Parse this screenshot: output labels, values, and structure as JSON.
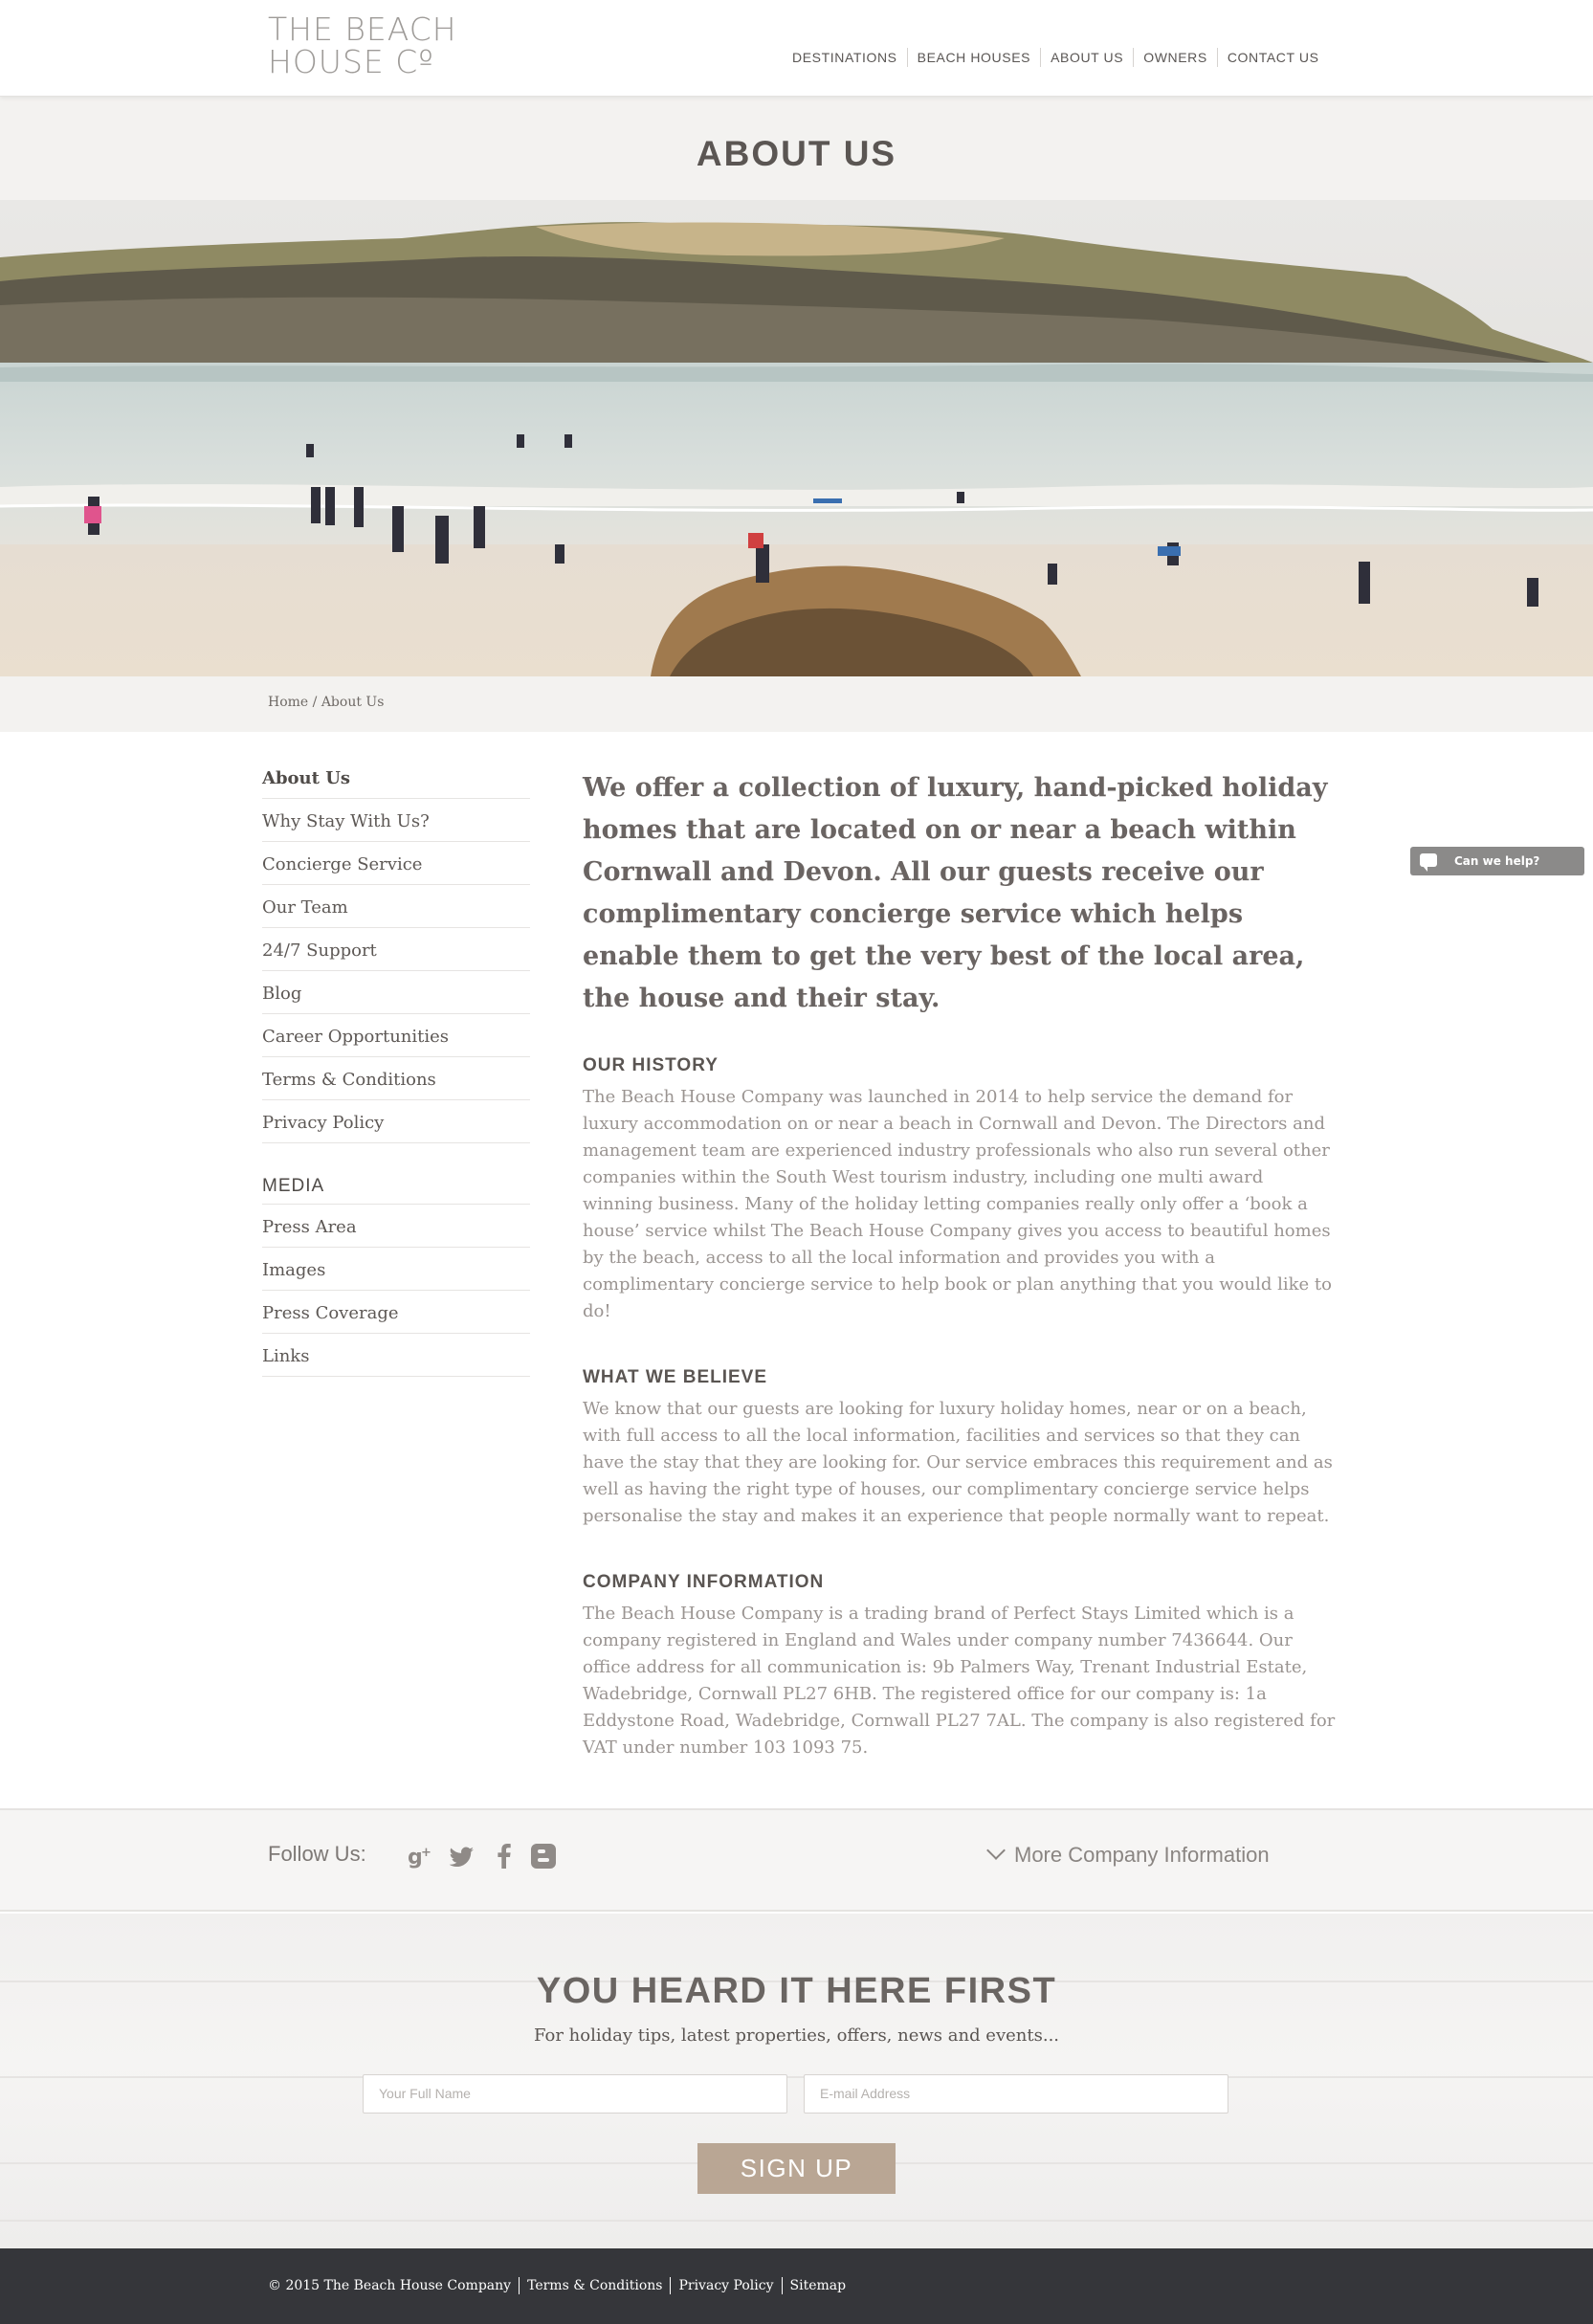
{
  "header": {
    "logo_line1": "THE BEACH",
    "logo_line2": "HOUSE Cº",
    "nav": [
      "DESTINATIONS",
      "BEACH HOUSES",
      "ABOUT US",
      "OWNERS",
      "CONTACT US"
    ]
  },
  "page_title": "ABOUT US",
  "breadcrumb": "Home / About Us",
  "sidebar": {
    "items": [
      "About Us",
      "Why Stay With Us?",
      "Concierge Service",
      "Our Team",
      "24/7 Support",
      "Blog",
      "Career Opportunities",
      "Terms & Conditions",
      "Privacy Policy"
    ],
    "media_heading": "MEDIA",
    "media_items": [
      "Press Area",
      "Images",
      "Press Coverage",
      "Links"
    ]
  },
  "main": {
    "lead": "We offer a collection of luxury, hand-picked holiday homes that are located on or near a beach within Cornwall and Devon. All our guests receive  our complimentary concierge service which helps enable them to get the very best of the local area, the house and their stay.",
    "history_heading": "OUR HISTORY",
    "history_text": "The Beach House Company was launched in 2014  to help service the demand for luxury accommodation on or near a beach in Cornwall and Devon. The Directors and management team are experienced industry professionals who also run several other companies within the South West tourism industry, including one multi award winning business. Many of the holiday letting companies really only offer a ‘book a  house’ service whilst The Beach House Company gives you access to beautiful homes by the beach, access to all the local information and provides you with a complimentary concierge service to help book or plan anything that you would like to do!",
    "believe_heading": "WHAT WE BELIEVE",
    "believe_text": "We  know that our guests are looking for luxury holiday homes, near or on a beach, with full access to all the local information, facilities and services so that they can have the stay that they are looking for. Our service embraces this requirement and as well as having the right type of houses, our complimentary concierge service helps personalise the stay and makes it an experience that people normally want to repeat.",
    "company_heading": "COMPANY INFORMATION",
    "company_text": "The Beach House Company is a trading brand of Perfect Stays Limited which is a company registered in England and Wales under company number 7436644. Our office address for all communication is: 9b Palmers Way, Trenant Industrial Estate, Wadebridge, Cornwall PL27 6HB. The registered office for our company is: 1a Eddystone Road, Wadebridge, Cornwall PL27 7AL. The company is also registered for VAT under number 103 1093 75."
  },
  "chat": {
    "label": "Can we help?",
    "icon": "speech-bubble-icon"
  },
  "follow": {
    "label": "Follow Us:",
    "icons": [
      "google-plus-icon",
      "twitter-icon",
      "facebook-icon",
      "blogger-icon"
    ],
    "more_info": "More Company Information"
  },
  "newsletter": {
    "title": "YOU HEARD IT HERE FIRST",
    "subtitle": "For holiday tips, latest properties, offers, news and events...",
    "name_placeholder": "Your Full Name",
    "email_placeholder": "E-mail Address",
    "button": "SIGN UP"
  },
  "footer": {
    "copyright": "© 2015 The Beach House Company",
    "links": [
      "Terms & Conditions",
      "Privacy Policy",
      "Sitemap"
    ]
  },
  "colors": {
    "accent_button": "#b9a694",
    "footer_bg": "#35363a",
    "band_bg": "#f3f2f0",
    "chat_bg": "#8b8a89"
  }
}
